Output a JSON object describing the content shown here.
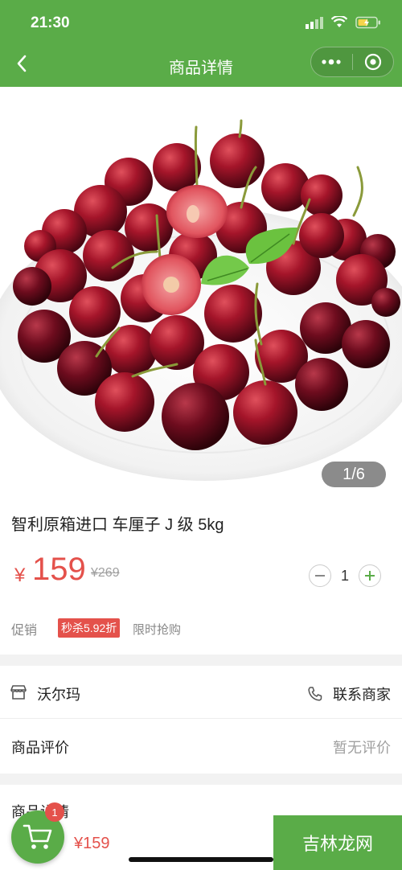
{
  "status": {
    "time": "21:30"
  },
  "nav": {
    "title": "商品详情"
  },
  "gallery": {
    "indicator": "1/6"
  },
  "product": {
    "name": "智利原箱进口 车厘子 J 级 5kg",
    "currency": "¥",
    "price": "159",
    "original_price": "¥269",
    "quantity": "1"
  },
  "promo": {
    "label": "促销",
    "badge": "秒杀5.92折",
    "text": "限时抢购"
  },
  "store": {
    "name": "沃尔玛",
    "contact": "联系商家",
    "review_label": "商品评价",
    "review_value": "暂无评价"
  },
  "detail": {
    "title": "商品详情"
  },
  "bottom": {
    "cart_count": "1",
    "price": "¥159",
    "add_button": "吉林龙网"
  },
  "colors": {
    "brand": "#5aac48",
    "price": "#e4514b"
  }
}
